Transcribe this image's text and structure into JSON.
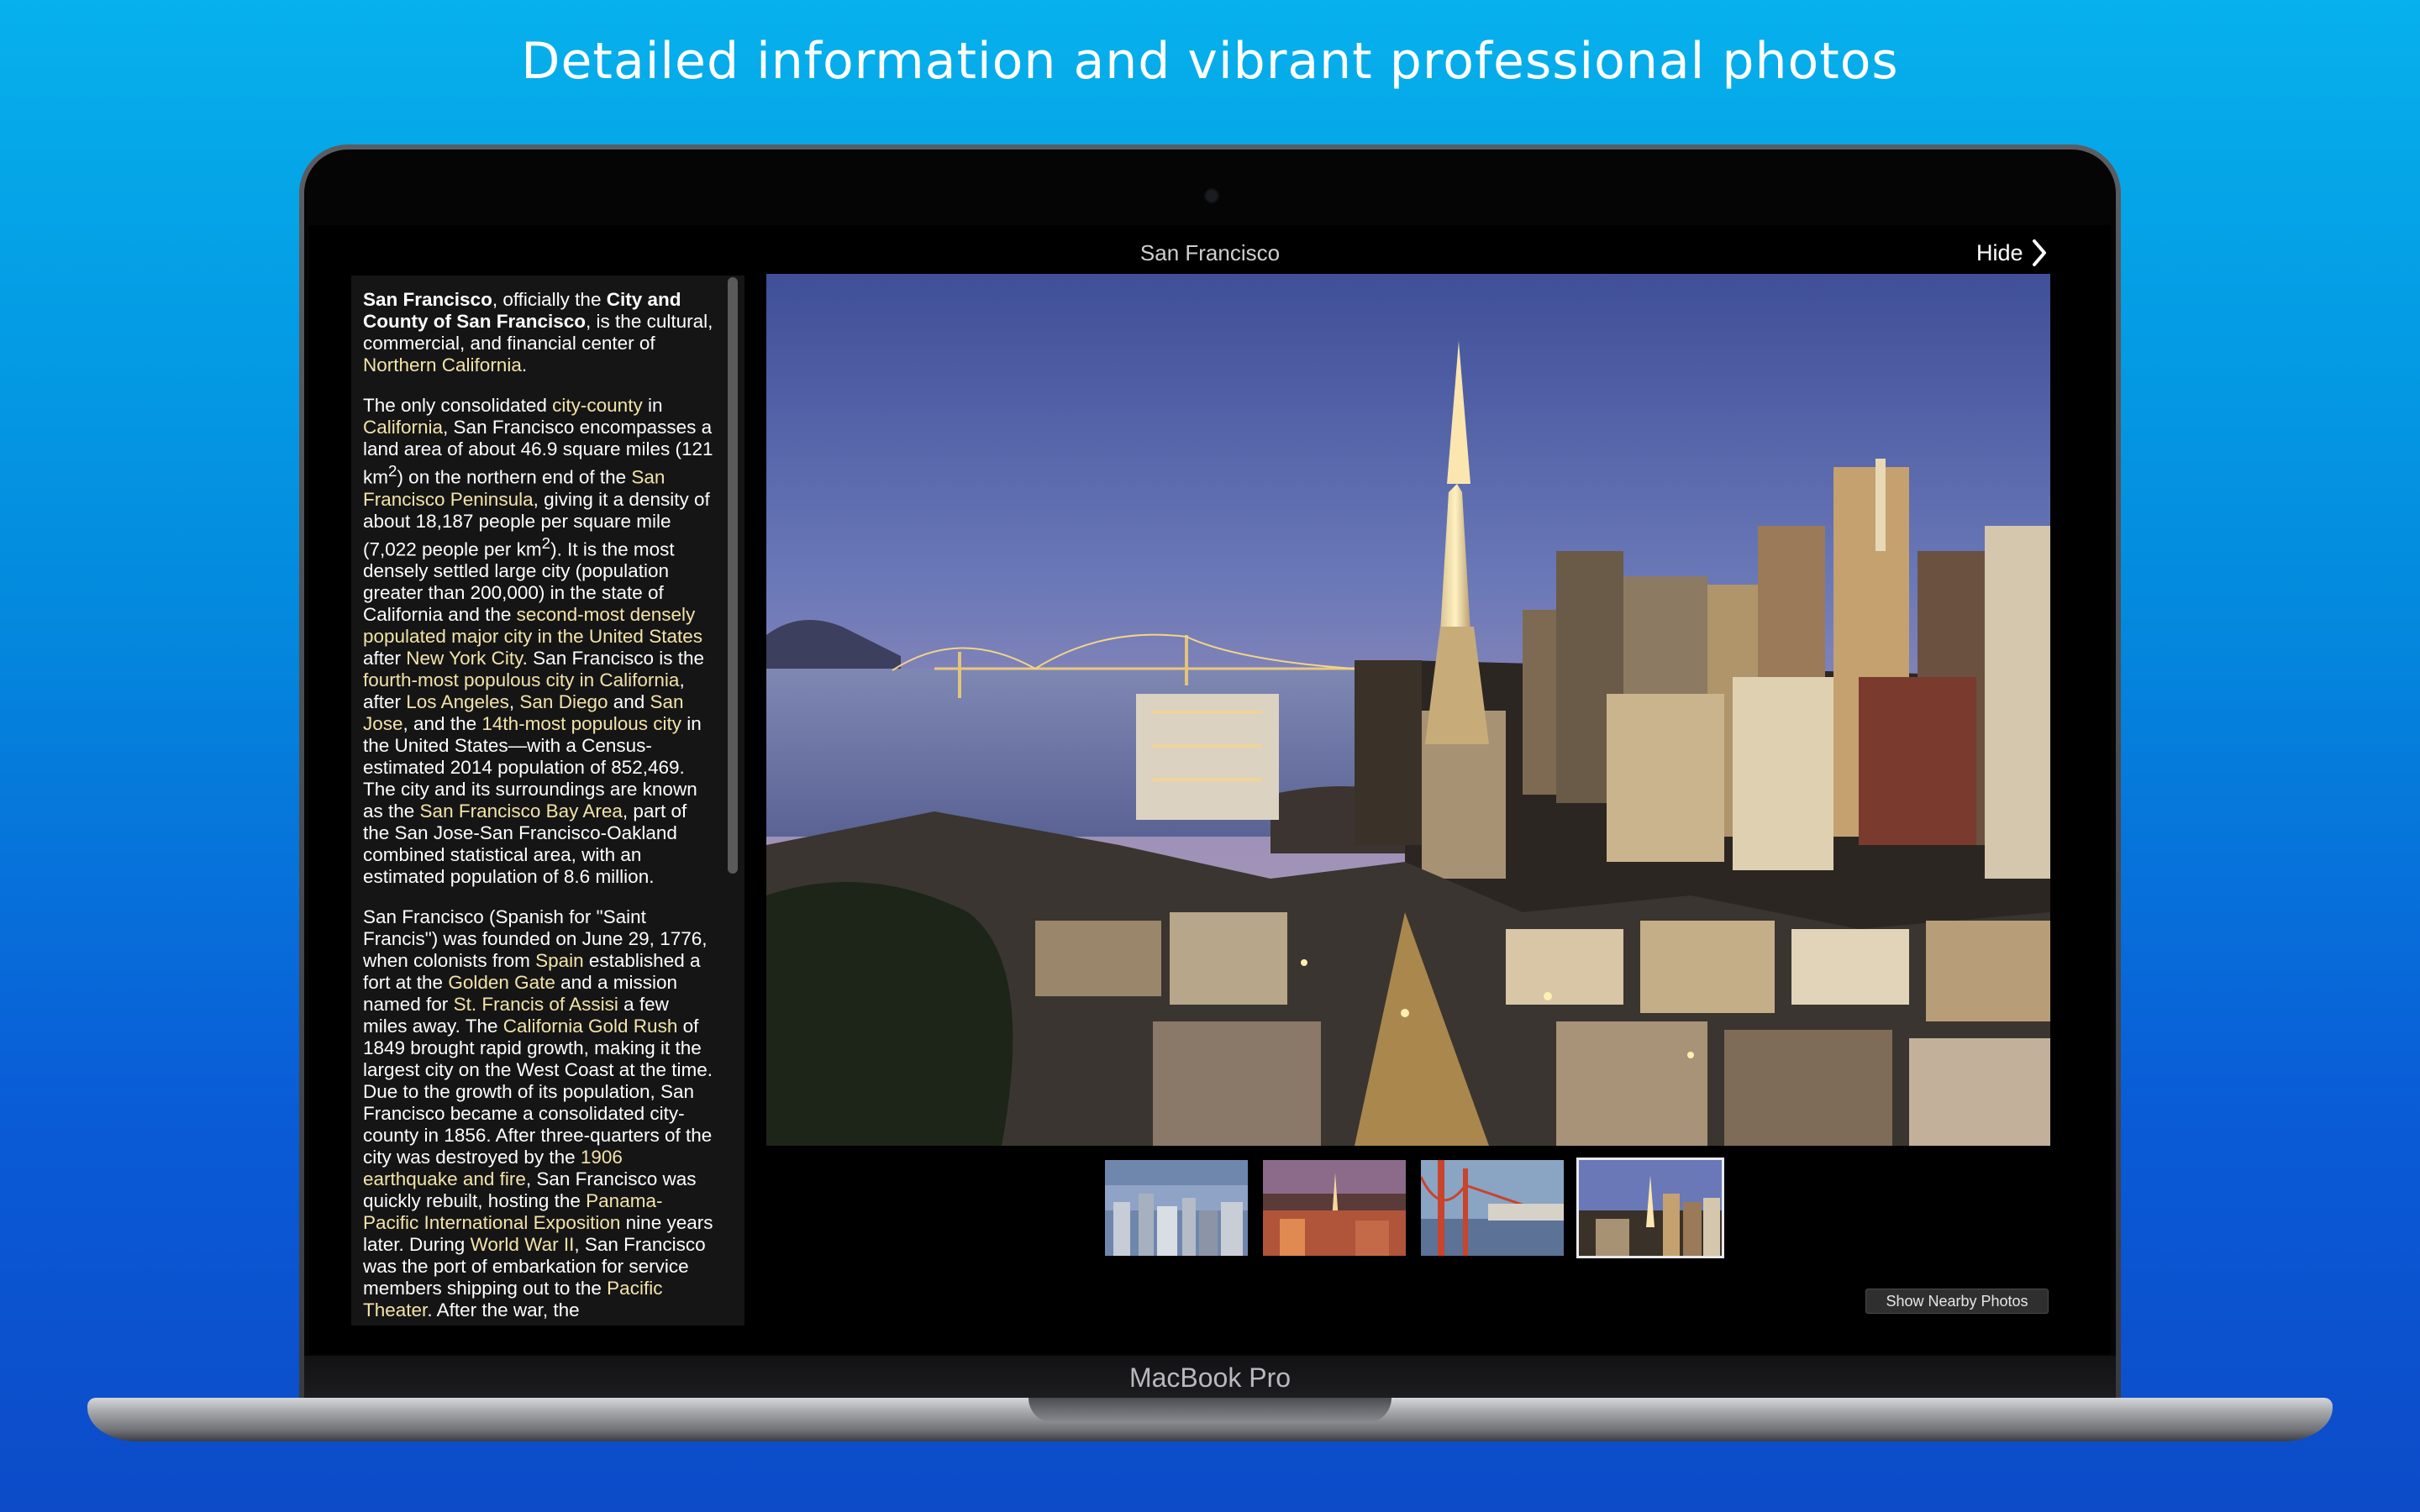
{
  "headline": "Detailed information and vibrant professional photos",
  "device_label": "MacBook Pro",
  "app": {
    "title": "San Francisco",
    "hide_label": "Hide"
  },
  "article": {
    "p1": {
      "a": "San Francisco",
      "b": ", officially the ",
      "c": "City and County of San Francisco",
      "d": ", is the cultural, commercial, and financial center of ",
      "e": "Northern California",
      "f": "."
    },
    "p2": {
      "a": "The only consolidated ",
      "b": "city-county",
      "c": " in ",
      "d": "California",
      "e": ", San Francisco encompasses a land area of about 46.9 square miles (121 km",
      "f": "2",
      "g": ") on the northern end of the ",
      "h": "San Francisco Peninsula",
      "i": ", giving it a density of about 18,187 people per square mile (7,022 people per km",
      "j": "2",
      "k": "). It is the most densely settled large city (population greater than 200,000) in the state of California and the ",
      "l": "second-most densely populated major city in the United States",
      "m": " after ",
      "n": "New York City",
      "o": ". San Francisco is the ",
      "p": "fourth-most populous city in California",
      "q": ", after ",
      "r": "Los Angeles",
      "s": ", ",
      "t": "San Diego",
      "u": " and ",
      "v": "San Jose",
      "w": ", and the ",
      "x": "14th-most populous city",
      "y": " in the United States—with a Census-estimated 2014 population of 852,469. The city and its surroundings are known as the ",
      "z": "San Francisco Bay Area",
      "aa": ", part of the San Jose-San Francisco-Oakland combined statistical area, with an estimated population of 8.6 million."
    },
    "p3": {
      "a": "San Francisco (Spanish for \"Saint Francis\") was founded on June 29, 1776, when colonists from ",
      "b": "Spain",
      "c": " established a fort at the ",
      "d": "Golden Gate",
      "e": " and a mission named for ",
      "f": "St. Francis of Assisi",
      "g": " a few miles away. The ",
      "h": "California Gold Rush",
      "i": " of 1849 brought rapid growth, making it the largest city on the West Coast at the time. Due to the growth of its population, San Francisco became a consolidated city-county in 1856. After three-quarters of the city was destroyed by the ",
      "j": "1906 earthquake and fire",
      "k": ", San Francisco was quickly rebuilt, hosting the ",
      "l": "Panama-Pacific International Exposition",
      "m": " nine years later. During ",
      "n": "World War II",
      "o": ", San Francisco was the port of embarkation for service members shipping out to the ",
      "p": "Pacific Theater",
      "q": ". After the war, the"
    }
  },
  "thumbnails": [
    {
      "name": "thumb-downtown-aerial",
      "selected": false
    },
    {
      "name": "thumb-transamerica-sunset",
      "selected": false
    },
    {
      "name": "thumb-golden-gate",
      "selected": false
    },
    {
      "name": "thumb-skyline-dusk",
      "selected": true
    }
  ],
  "nearby_button": "Show Nearby Photos",
  "icons": {
    "hide": "chevron-right-icon",
    "camera": "camera-dot"
  },
  "colors": {
    "link": "#f4e3a8",
    "background_top": "#06b1ec",
    "background_bottom": "#0d4bc8"
  }
}
